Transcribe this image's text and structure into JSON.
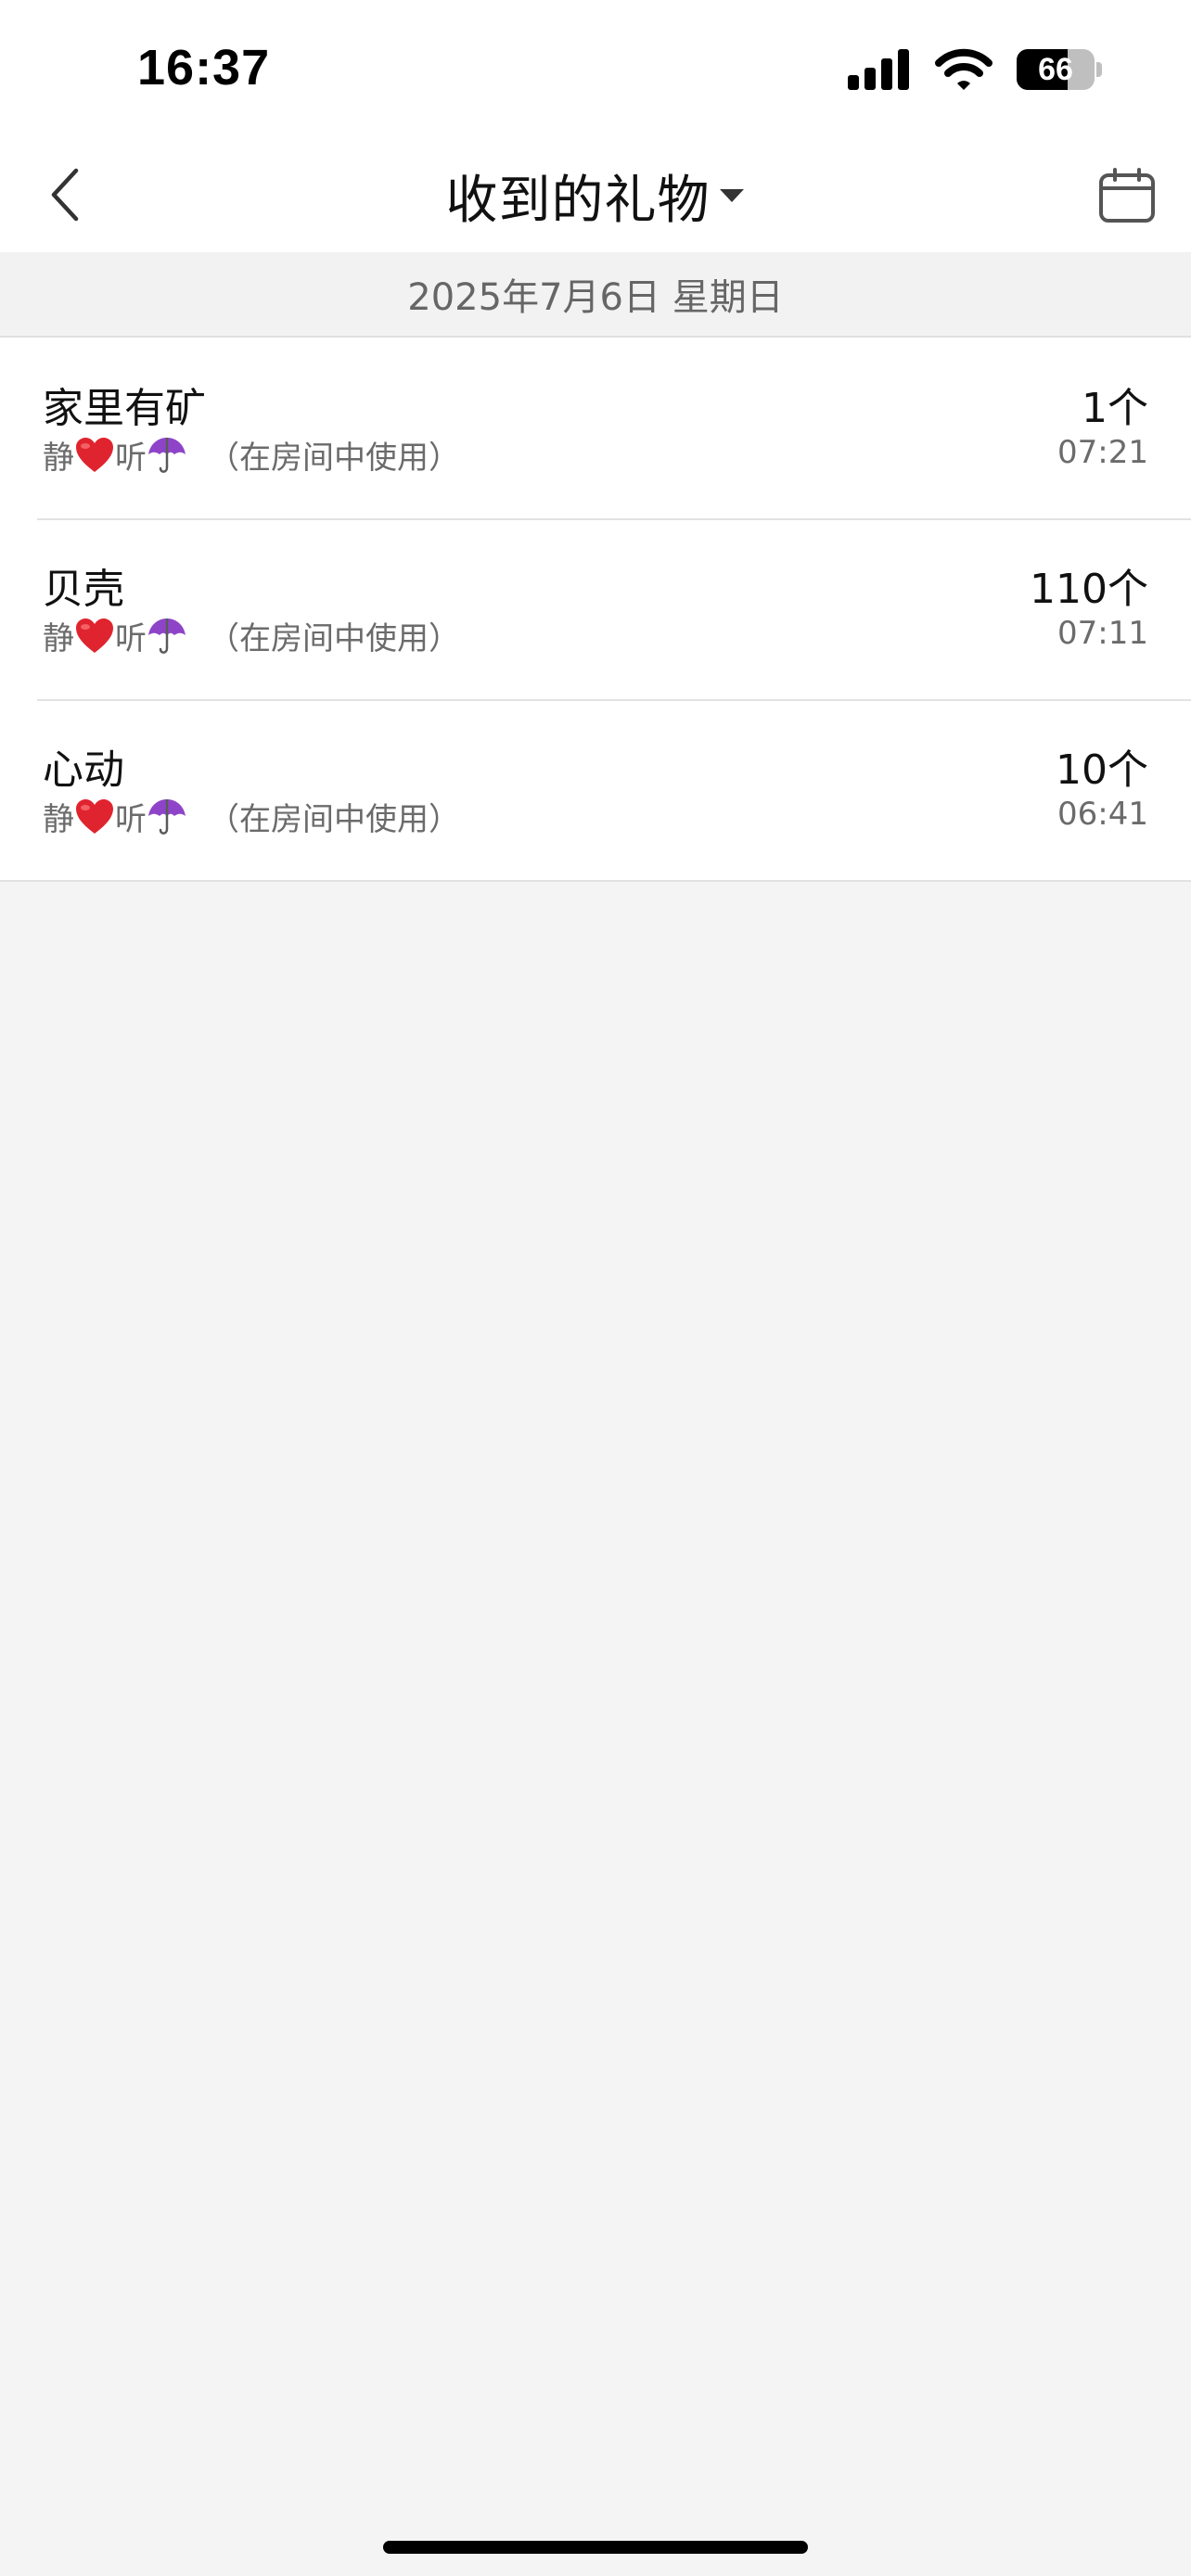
{
  "status_bar": {
    "time": "16:37",
    "battery_level": "66",
    "battery_fraction": 0.66,
    "icons": [
      "signal-icon",
      "wifi-icon",
      "battery-icon"
    ]
  },
  "nav": {
    "title": "收到的礼物",
    "back_icon": "chevron-left-icon",
    "dropdown_icon": "caret-down-icon",
    "calendar_icon": "calendar-icon"
  },
  "date_header": "2025年7月6日 星期日",
  "gifts": [
    {
      "name": "家里有矿",
      "sender_part1": "静",
      "sender_part2": "听",
      "usage": "（在房间中使用）",
      "count": "1个",
      "time": "07:21"
    },
    {
      "name": "贝壳",
      "sender_part1": "静",
      "sender_part2": "听",
      "usage": "（在房间中使用）",
      "count": "110个",
      "time": "07:11"
    },
    {
      "name": "心动",
      "sender_part1": "静",
      "sender_part2": "听",
      "usage": "（在房间中使用）",
      "count": "10个",
      "time": "06:41"
    }
  ],
  "colors": {
    "heart": "#e0242f",
    "umbrella": "#8e44c8",
    "background": "#f4f4f4",
    "secondary_text": "#6b6b6b"
  }
}
